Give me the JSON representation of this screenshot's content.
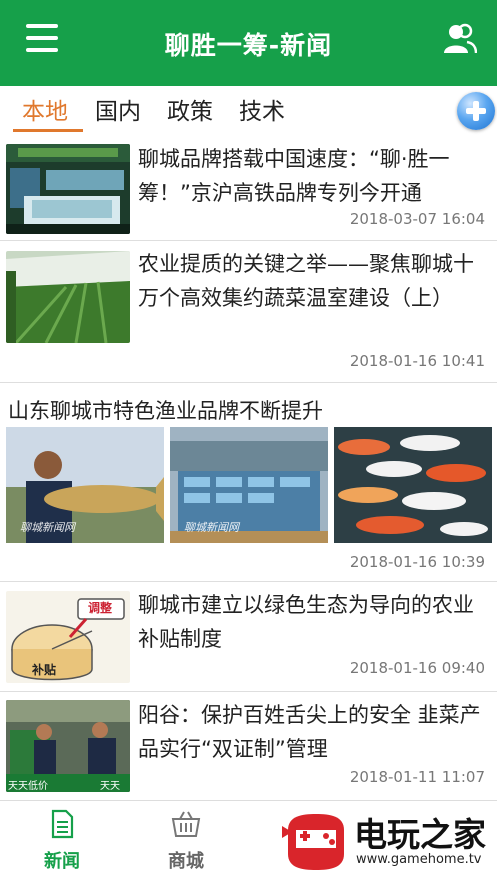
{
  "header": {
    "title": "聊胜一筹-新闻",
    "menu_icon": "menu-icon",
    "user_icon": "users-icon"
  },
  "tabs": [
    {
      "label": "本地"
    },
    {
      "label": "国内"
    },
    {
      "label": "政策"
    },
    {
      "label": "技术"
    }
  ],
  "colors": {
    "brand": "#16a04a",
    "active_tab": "#e0782d",
    "add_button": "#2f86e0"
  },
  "news": [
    {
      "title": "聊城品牌搭载中国速度：“聊·胜一筹！”京沪高铁品牌专列今开通",
      "time": "2018-03-07 16:04"
    },
    {
      "title": "农业提质的关键之举——聚焦聊城十万个高效集约蔬菜温室建设（上）",
      "time": "2018-01-16 10:41"
    },
    {
      "title": "山东聊城市特色渔业品牌不断提升",
      "time": "2018-01-16 10:39",
      "watermark": "聊城新闻网"
    },
    {
      "title": "聊城市建立以绿色生态为导向的农业补贴制度",
      "time": "2018-01-16 09:40",
      "cartoon_labels": [
        "调整",
        "补贴"
      ]
    },
    {
      "title": "阳谷：保护百姓舌尖上的安全 韭菜产品实行“双证制”管理",
      "time": "2018-01-11 11:07",
      "market_sign": [
        "天天低价",
        "天天"
      ]
    }
  ],
  "bottom_nav": [
    {
      "label": "新闻",
      "icon": "news-icon",
      "active": true
    },
    {
      "label": "商城",
      "icon": "basket-icon",
      "active": false
    }
  ],
  "site_watermark": {
    "name": "电玩之家",
    "url": "www.gamehome.tv"
  }
}
